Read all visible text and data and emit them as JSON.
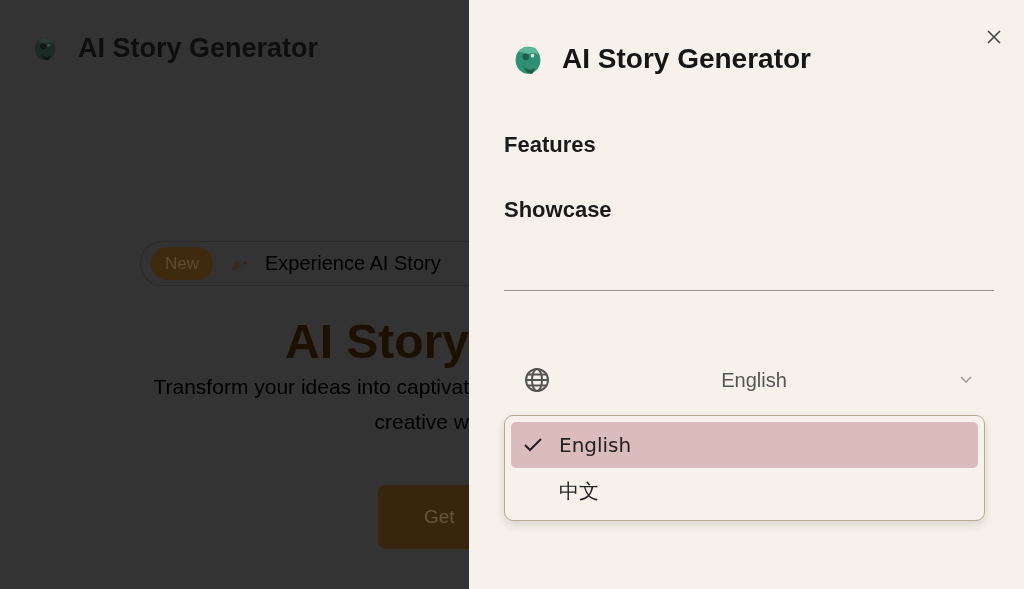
{
  "background_page": {
    "brand": "AI Story Generator",
    "badge": {
      "label": "New",
      "text": "Experience AI Story"
    },
    "hero_title": "AI Story",
    "subtitle_lines": [
      "Transform your ideas into captivat",
      "creative w"
    ],
    "button": "Get"
  },
  "drawer": {
    "brand": "AI Story Generator",
    "nav_items": [
      "Features",
      "Showcase"
    ],
    "language_select": {
      "value": "English",
      "expanded": true
    },
    "language_options": [
      {
        "label": "English",
        "selected": true
      },
      {
        "label": "中文",
        "selected": false
      }
    ]
  }
}
